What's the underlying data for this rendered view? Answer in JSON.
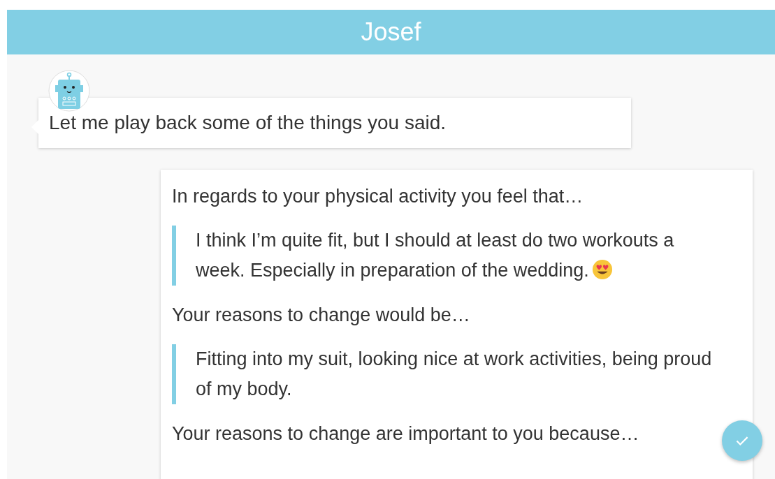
{
  "header": {
    "title": "Josef"
  },
  "bot_message": {
    "text": "Let me play back some of the things you said."
  },
  "summary": [
    {
      "kind": "prompt",
      "text": "In regards to your physical activity you feel that…"
    },
    {
      "kind": "quote",
      "text": "I think I’m quite fit, but I should at least do two workouts a week. Especially in preparation of the wedding.",
      "emoji": true
    },
    {
      "kind": "prompt",
      "text": "Your reasons to change would be…"
    },
    {
      "kind": "quote",
      "text": "Fitting into my suit, looking nice at work activities, being proud of my body.",
      "emoji": false
    },
    {
      "kind": "prompt",
      "text": "Your reasons to change are important to you because…"
    }
  ]
}
